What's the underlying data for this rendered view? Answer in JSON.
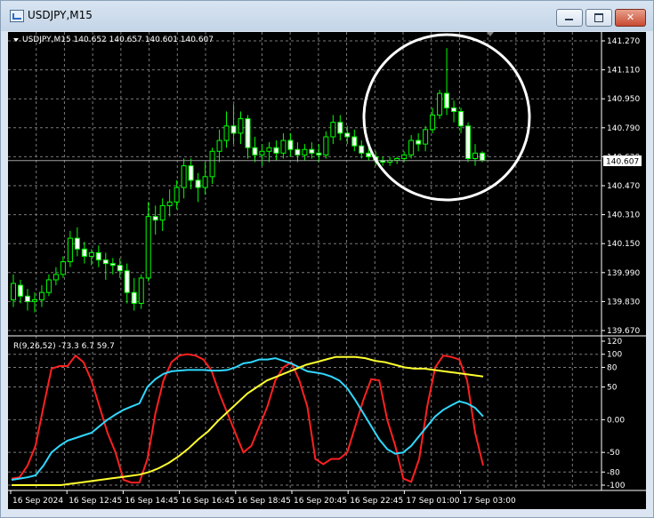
{
  "window": {
    "title": "USDJPY,M15"
  },
  "main_chart": {
    "info": "USDJPY,M15  140.652 140.657 140.601 140.607",
    "current_price": "140.607",
    "price_ticks": [
      "141.270",
      "141.110",
      "140.950",
      "140.790",
      "140.630",
      "140.470",
      "140.310",
      "140.150",
      "139.990",
      "139.830",
      "139.670"
    ]
  },
  "indicator": {
    "info": "R(9,26,52) -73.3 6.7 59.7",
    "ticks": [
      "120",
      "100",
      "80",
      "50",
      "0.00",
      "-50",
      "-80",
      "-100"
    ]
  },
  "time_labels": [
    "16 Sep 2024",
    "16 Sep 12:45",
    "16 Sep 14:45",
    "16 Sep 16:45",
    "16 Sep 18:45",
    "16 Sep 20:45",
    "16 Sep 22:45",
    "17 Sep 01:00",
    "17 Sep 03:00"
  ],
  "chart_data": [
    {
      "type": "candlestick",
      "title": "USDJPY,M15",
      "ylim": [
        139.67,
        141.27
      ],
      "grid": true,
      "annotation": "circle highlighting spike near 17 Sep 01:00",
      "ohlc": [
        [
          139.84,
          139.98,
          139.8,
          139.93
        ],
        [
          139.92,
          139.95,
          139.82,
          139.86
        ],
        [
          139.86,
          139.9,
          139.78,
          139.83
        ],
        [
          139.83,
          139.88,
          139.77,
          139.84
        ],
        [
          139.84,
          139.92,
          139.8,
          139.88
        ],
        [
          139.88,
          139.98,
          139.86,
          139.95
        ],
        [
          139.95,
          140.02,
          139.92,
          139.98
        ],
        [
          139.98,
          140.08,
          139.96,
          140.05
        ],
        [
          140.05,
          140.22,
          140.02,
          140.18
        ],
        [
          140.18,
          140.24,
          140.08,
          140.12
        ],
        [
          140.12,
          140.16,
          140.04,
          140.08
        ],
        [
          140.08,
          140.12,
          140.03,
          140.1
        ],
        [
          140.1,
          140.14,
          140.02,
          140.06
        ],
        [
          140.06,
          140.1,
          139.95,
          140.04
        ],
        [
          140.04,
          140.07,
          139.98,
          140.03
        ],
        [
          140.03,
          140.07,
          139.96,
          140.0
        ],
        [
          140.0,
          140.04,
          139.82,
          139.88
        ],
        [
          139.88,
          139.96,
          139.78,
          139.82
        ],
        [
          139.82,
          139.98,
          139.79,
          139.96
        ],
        [
          139.96,
          140.38,
          139.94,
          140.3
        ],
        [
          140.3,
          140.36,
          140.2,
          140.28
        ],
        [
          140.28,
          140.4,
          140.22,
          140.36
        ],
        [
          140.36,
          140.45,
          140.3,
          140.38
        ],
        [
          140.38,
          140.5,
          140.34,
          140.46
        ],
        [
          140.46,
          140.62,
          140.4,
          140.58
        ],
        [
          140.58,
          140.62,
          140.45,
          140.5
        ],
        [
          140.5,
          140.54,
          140.38,
          140.46
        ],
        [
          140.46,
          140.6,
          140.42,
          140.52
        ],
        [
          140.52,
          140.68,
          140.48,
          140.66
        ],
        [
          140.66,
          140.78,
          140.6,
          140.72
        ],
        [
          140.72,
          140.88,
          140.68,
          140.8
        ],
        [
          140.8,
          140.92,
          140.7,
          140.76
        ],
        [
          140.76,
          140.88,
          140.7,
          140.84
        ],
        [
          140.84,
          140.86,
          140.62,
          140.68
        ],
        [
          140.68,
          140.74,
          140.6,
          140.64
        ],
        [
          140.64,
          140.7,
          140.58,
          140.66
        ],
        [
          140.66,
          140.71,
          140.6,
          140.68
        ],
        [
          140.68,
          140.72,
          140.61,
          140.65
        ],
        [
          140.65,
          140.76,
          140.62,
          140.72
        ],
        [
          140.72,
          140.76,
          140.63,
          140.67
        ],
        [
          140.67,
          140.71,
          140.6,
          140.64
        ],
        [
          140.64,
          140.7,
          140.61,
          140.67
        ],
        [
          140.67,
          140.71,
          140.62,
          140.65
        ],
        [
          140.65,
          140.7,
          140.6,
          140.64
        ],
        [
          140.64,
          140.77,
          140.62,
          140.74
        ],
        [
          140.74,
          140.86,
          140.7,
          140.82
        ],
        [
          140.82,
          140.86,
          140.72,
          140.76
        ],
        [
          140.76,
          140.8,
          140.7,
          140.74
        ],
        [
          140.74,
          140.78,
          140.66,
          140.69
        ],
        [
          140.69,
          140.72,
          140.62,
          140.65
        ],
        [
          140.65,
          140.68,
          140.61,
          140.63
        ],
        [
          140.63,
          140.66,
          140.58,
          140.61
        ],
        [
          140.61,
          140.63,
          140.58,
          140.6
        ],
        [
          140.6,
          140.63,
          140.58,
          140.61
        ],
        [
          140.61,
          140.63,
          140.59,
          140.62
        ],
        [
          140.62,
          140.66,
          140.6,
          140.64
        ],
        [
          140.64,
          140.75,
          140.62,
          140.72
        ],
        [
          140.72,
          140.76,
          140.66,
          140.7
        ],
        [
          140.7,
          140.8,
          140.66,
          140.78
        ],
        [
          140.78,
          140.9,
          140.76,
          140.86
        ],
        [
          140.86,
          141.0,
          140.84,
          140.98
        ],
        [
          140.98,
          141.23,
          140.86,
          140.9
        ],
        [
          140.9,
          140.94,
          140.82,
          140.88
        ],
        [
          140.88,
          140.9,
          140.76,
          140.8
        ],
        [
          140.8,
          140.82,
          140.6,
          140.62
        ],
        [
          140.62,
          140.7,
          140.58,
          140.65
        ],
        [
          140.65,
          140.66,
          140.6,
          140.61
        ]
      ]
    },
    {
      "type": "line",
      "title": "R(9,26,52)",
      "ylim": [
        -100,
        120
      ],
      "grid": true,
      "series": [
        {
          "name": "R9",
          "color": "#ff2020",
          "values": [
            -90,
            -88,
            -70,
            -40,
            20,
            78,
            82,
            82,
            98,
            88,
            60,
            20,
            -20,
            -50,
            -92,
            -96,
            -96,
            -60,
            10,
            60,
            88,
            98,
            100,
            98,
            92,
            75,
            40,
            10,
            -20,
            -50,
            -40,
            -10,
            20,
            60,
            80,
            88,
            60,
            20,
            -60,
            -68,
            -60,
            -60,
            -50,
            -10,
            30,
            62,
            60,
            0,
            -40,
            -90,
            -95,
            -60,
            20,
            80,
            98,
            96,
            92,
            60,
            -20,
            -70
          ]
        },
        {
          "name": "R26",
          "color": "#30d8ff",
          "values": [
            -92,
            -90,
            -88,
            -85,
            -70,
            -50,
            -40,
            -32,
            -28,
            -24,
            -20,
            -10,
            0,
            8,
            15,
            20,
            25,
            50,
            62,
            70,
            74,
            75,
            76,
            76,
            76,
            75,
            75,
            76,
            80,
            86,
            88,
            92,
            92,
            94,
            90,
            86,
            80,
            74,
            72,
            70,
            66,
            60,
            48,
            30,
            10,
            -10,
            -30,
            -45,
            -52,
            -50,
            -40,
            -25,
            -10,
            5,
            15,
            22,
            28,
            25,
            18,
            5
          ]
        },
        {
          "name": "R52",
          "color": "#ffff30",
          "values": [
            -100,
            -100,
            -100,
            -100,
            -100,
            -100,
            -98,
            -96,
            -94,
            -92,
            -90,
            -88,
            -86,
            -84,
            -80,
            -74,
            -66,
            -56,
            -44,
            -30,
            -18,
            -2,
            12,
            26,
            40,
            50,
            60,
            66,
            72,
            78,
            84,
            88,
            92,
            96,
            96,
            96,
            94,
            90,
            88,
            84,
            80,
            78,
            78,
            76,
            74,
            72,
            70,
            68,
            66
          ]
        }
      ]
    }
  ]
}
